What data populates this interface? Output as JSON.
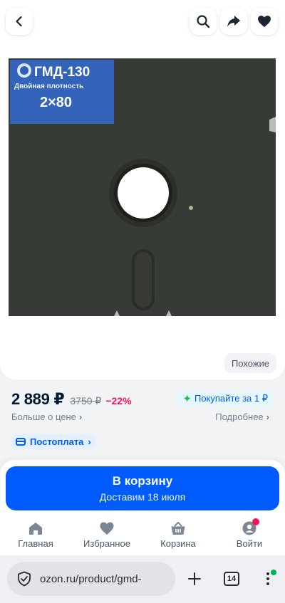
{
  "colors": {
    "accent": "#005bff",
    "discount": "#f91155",
    "text_primary": "#001a34",
    "text_secondary": "#707f8d"
  },
  "top_bar": {
    "back_icon": "chevron-left-icon",
    "search_icon": "search-icon",
    "share_icon": "share-icon",
    "favorite_icon": "heart-icon"
  },
  "product_image": {
    "label_brand": "ГМД-130",
    "label_density": "Двойная плотность",
    "label_format": "2×80"
  },
  "similar_label": "Похожие",
  "price": {
    "current": "2 889 ₽",
    "old": "3750 ₽",
    "discount": "−22%",
    "more_label": "Больше о цене",
    "ruble_offer": "Покупайте за 1 ₽",
    "details_label": "Подробнее",
    "postpay_label": "Постоплата"
  },
  "cart_button": {
    "title": "В корзину",
    "subtitle": "Доставим 18 июля"
  },
  "bottom_nav": {
    "items": [
      {
        "label": "Главная",
        "icon": "home-icon"
      },
      {
        "label": "Избранное",
        "icon": "heart-icon"
      },
      {
        "label": "Корзина",
        "icon": "basket-icon"
      },
      {
        "label": "Войти",
        "icon": "user-icon"
      }
    ]
  },
  "browser": {
    "url": "ozon.ru/product/gmd-",
    "tabs_count": "14",
    "new_tab_icon": "plus-icon",
    "menu_icon": "more-vertical-icon",
    "security_icon": "shield-check-icon"
  }
}
